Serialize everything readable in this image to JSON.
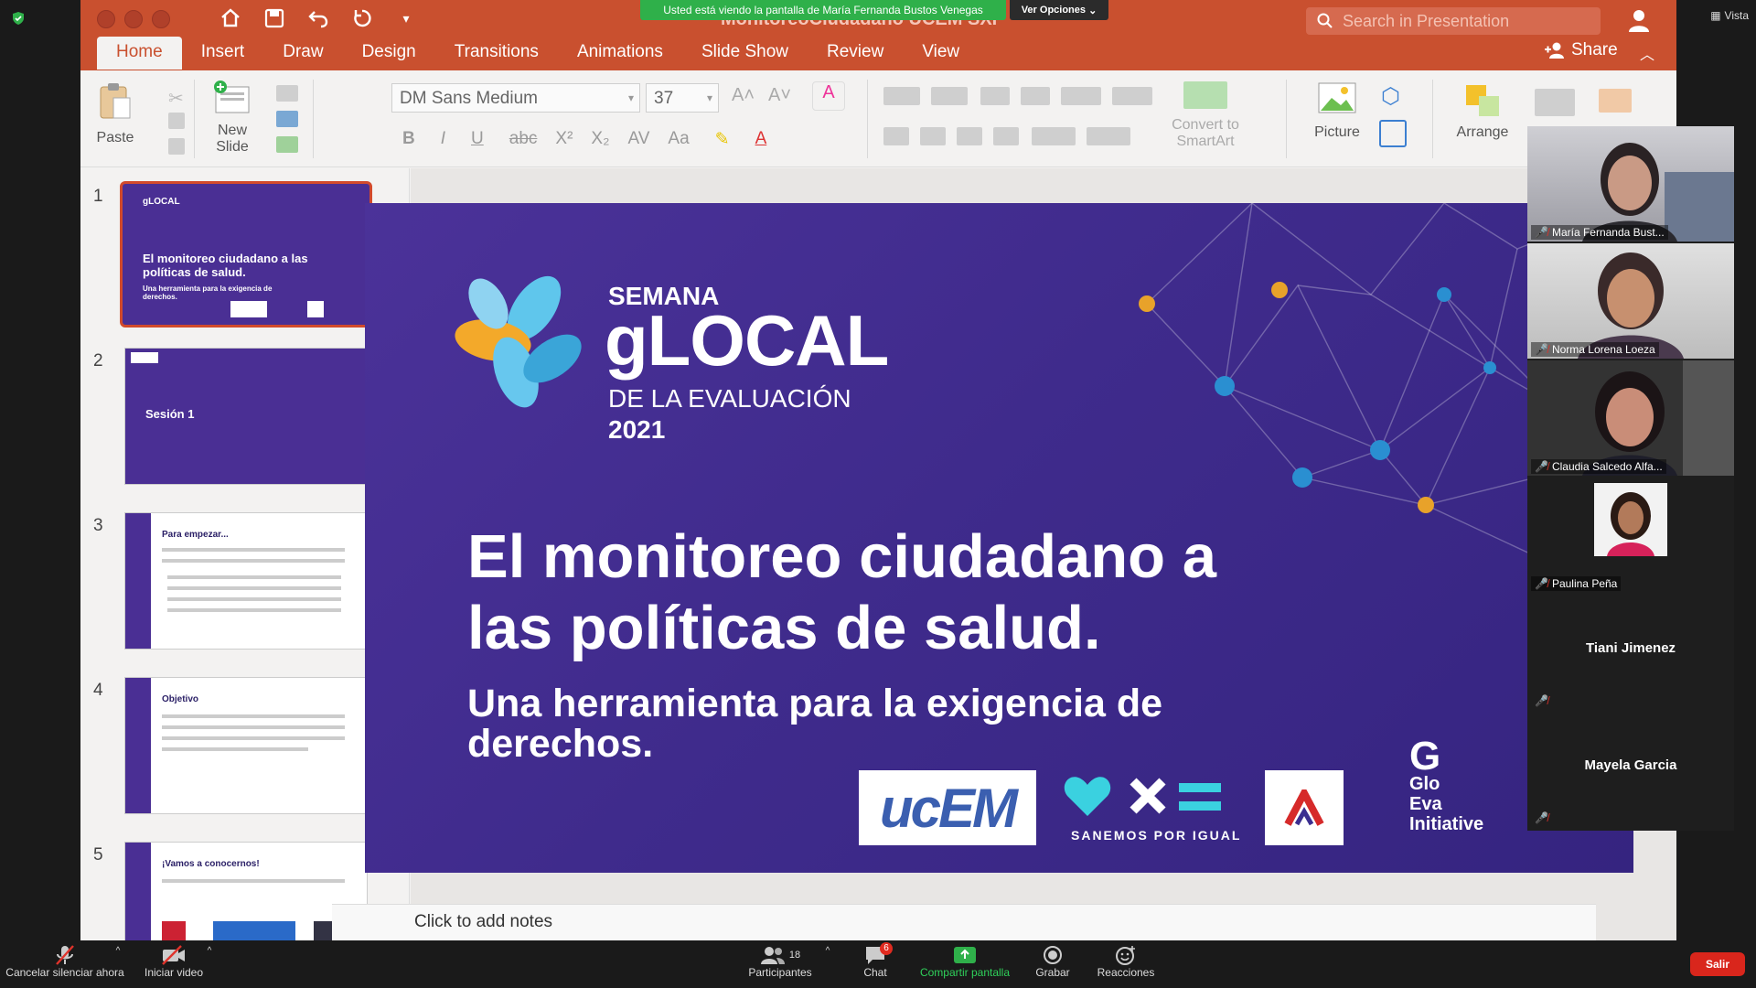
{
  "zoom": {
    "vista_label": "Vista",
    "share_banner": "Usted está viendo la pantalla de María Fernanda Bustos Venegas",
    "ver_opciones": "Ver Opciones",
    "bottom": {
      "mute": "Cancelar silenciar ahora",
      "video": "Iniciar video",
      "participants": "Participantes",
      "participants_count": "18",
      "chat": "Chat",
      "chat_badge": "6",
      "share": "Compartir pantalla",
      "record": "Grabar",
      "reactions": "Reacciones",
      "leave": "Salir"
    },
    "participants_list": [
      {
        "name": "María Fernanda Bust..."
      },
      {
        "name": "Norma Lorena Loeza"
      },
      {
        "name": "Claudia Salcedo Alfa..."
      },
      {
        "name": "Paulina Peña"
      },
      {
        "name": "Tiani Jimenez"
      },
      {
        "name": "Mayela Garcia"
      }
    ]
  },
  "ppt": {
    "doc_title": "MonitoreoCiudadano UCEM SXI",
    "search_placeholder": "Search in Presentation",
    "share_label": "Share",
    "tabs": [
      "Home",
      "Insert",
      "Draw",
      "Design",
      "Transitions",
      "Animations",
      "Slide Show",
      "Review",
      "View"
    ],
    "ribbon": {
      "paste": "Paste",
      "new_slide_1": "New",
      "new_slide_2": "Slide",
      "font": "DM Sans Medium",
      "size": "37",
      "convert_1": "Convert to",
      "convert_2": "SmartArt",
      "picture": "Picture",
      "arrange": "Arrange"
    },
    "notes_placeholder": "Click to add notes",
    "thumbnails": [
      {
        "num": "1",
        "title": "El monitoreo ciudadano a las políticas de salud.",
        "sub": "Una herramienta para la exigencia de derechos."
      },
      {
        "num": "2",
        "title": "Sesión 1"
      },
      {
        "num": "3",
        "title": "Para empezar..."
      },
      {
        "num": "4",
        "title": "Objetivo"
      },
      {
        "num": "5",
        "title": "¡Vamos a conocernos!"
      }
    ],
    "slide": {
      "semana": "SEMANA",
      "glocal": "gLOCAL",
      "de_la_evaluacion": "DE LA EVALUACIÓN",
      "year": "2021",
      "title_line1": "El monitoreo ciudadano a",
      "title_line2": "las políticas de salud.",
      "subtitle_line1": "Una herramienta para la exigencia de",
      "subtitle_line2": "derechos.",
      "ucem_logo": "ucEM",
      "sanemos": "SANEMOS POR IGUAL",
      "gei_1": "G",
      "gei_2": "Glo",
      "gei_3": "Eva",
      "gei_4": "Initiative"
    }
  }
}
